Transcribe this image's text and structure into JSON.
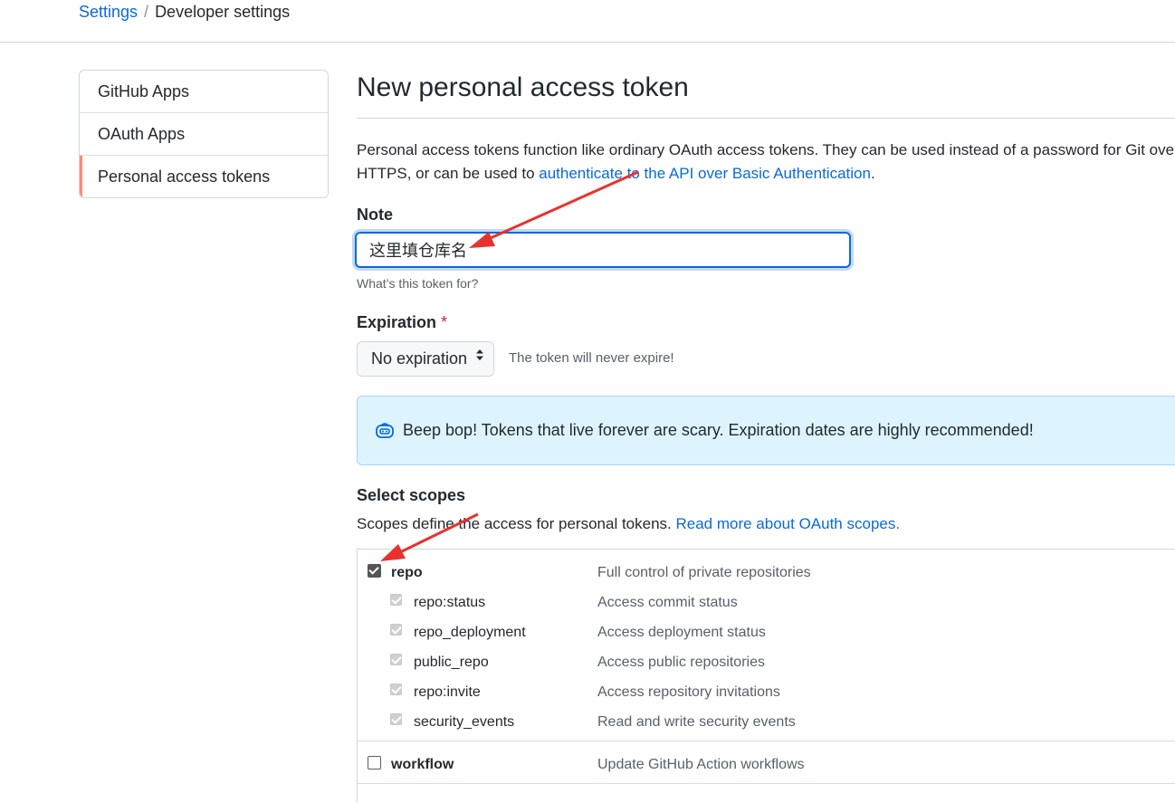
{
  "breadcrumb": {
    "parent": "Settings",
    "separator": "/",
    "current": "Developer settings"
  },
  "sidebar": {
    "items": [
      {
        "label": "GitHub Apps"
      },
      {
        "label": "OAuth Apps"
      },
      {
        "label": "Personal access tokens",
        "selected": true
      }
    ]
  },
  "page": {
    "title": "New personal access token",
    "intro_text": "Personal access tokens function like ordinary OAuth access tokens. They can be used instead of a password for Git ove",
    "intro_text_2": "HTTPS, or can be used to ",
    "intro_link": "authenticate to the API over Basic Authentication",
    "intro_end": "."
  },
  "note": {
    "label": "Note",
    "value": "这里填仓库名",
    "hint": "What’s this token for?"
  },
  "expiration": {
    "label": "Expiration",
    "required_marker": "*",
    "selected": "No expiration",
    "note": "The token will never expire!"
  },
  "flash": {
    "message": "Beep bop! Tokens that live forever are scary. Expiration dates are highly recommended!"
  },
  "scopes": {
    "label": "Select scopes",
    "description": "Scopes define the access for personal tokens. ",
    "link": "Read more about OAuth scopes.",
    "items": [
      {
        "name": "repo",
        "description": "Full control of private repositories",
        "checked": true
      },
      {
        "name": "repo:status",
        "description": "Access commit status",
        "checked": true
      },
      {
        "name": "repo_deployment",
        "description": "Access deployment status",
        "checked": true
      },
      {
        "name": "public_repo",
        "description": "Access public repositories",
        "checked": true
      },
      {
        "name": "repo:invite",
        "description": "Access repository invitations",
        "checked": true
      },
      {
        "name": "security_events",
        "description": "Read and write security events",
        "checked": true
      },
      {
        "name": "workflow",
        "description": "Update GitHub Action workflows",
        "checked": false
      }
    ]
  },
  "colors": {
    "link": "#0969da",
    "selected_accent": "#fd8c73",
    "annotation_arrow": "#e8322d",
    "flash_bg": "#ddf4ff"
  },
  "icons": {
    "flash": "bot-icon",
    "select": "chevron-up-down-icon"
  }
}
